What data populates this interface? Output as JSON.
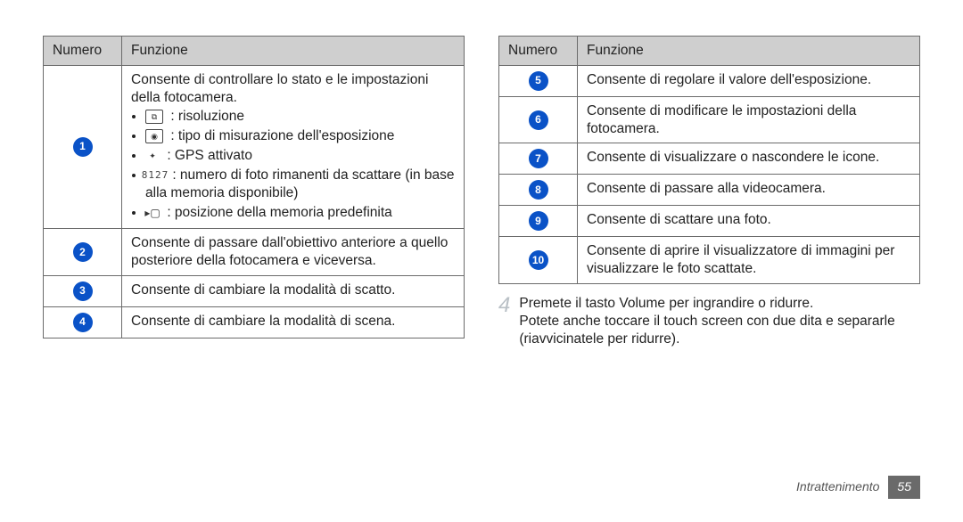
{
  "headers": {
    "num": "Numero",
    "fn": "Funzione"
  },
  "icons": {
    "res": "⧉",
    "meter": "◉",
    "gps": "✦",
    "count": "8127",
    "mem": "▸▢"
  },
  "left": {
    "r1": {
      "intro": "Consente di controllare lo stato e le impostazioni della fotocamera.",
      "bullets": {
        "res": ": risoluzione",
        "meter": ": tipo di misurazione dell'esposizione",
        "gps": ": GPS attivato",
        "count": ": numero di foto rimanenti da scattare (in base alla memoria disponibile)",
        "mem": ": posizione della memoria predefinita"
      }
    },
    "r2": "Consente di passare dall'obiettivo anteriore a quello posteriore della fotocamera e viceversa.",
    "r3": "Consente di cambiare la modalità di scatto.",
    "r4": "Consente di cambiare la modalità di scena."
  },
  "right": {
    "r5": "Consente di regolare il valore dell'esposizione.",
    "r6": "Consente di modificare le impostazioni della fotocamera.",
    "r7": "Consente di visualizzare o nascondere le icone.",
    "r8": "Consente di passare alla videocamera.",
    "r9": "Consente di scattare una foto.",
    "r10": "Consente di aprire il visualizzatore di immagini per visualizzare le foto scattate."
  },
  "step": {
    "n": "4",
    "p1": "Premete il tasto Volume per ingrandire o ridurre.",
    "p2": "Potete anche toccare il touch screen con due dita e separarle (riavvicinatele per ridurre)."
  },
  "footer": {
    "section": "Intrattenimento",
    "page": "55"
  }
}
